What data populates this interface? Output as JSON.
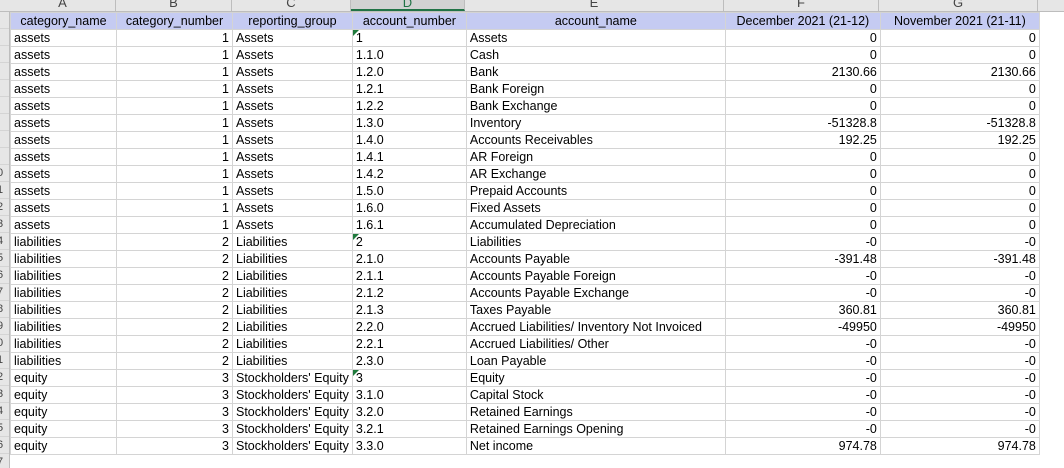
{
  "column_letters": [
    "A",
    "B",
    "C",
    "D",
    "E",
    "F",
    "G"
  ],
  "selected_column": "D",
  "row_numbers": [
    "",
    "",
    "",
    "",
    "",
    "",
    "",
    "",
    "",
    "0",
    "1",
    "2",
    "3",
    "4",
    "5",
    "6",
    "7",
    "8",
    "9",
    "0",
    "1",
    "2",
    "3",
    "4",
    "5",
    "6",
    "7"
  ],
  "headers": [
    "category_name",
    "category_number",
    "reporting_group",
    "account_number",
    "account_name",
    "December 2021 (21-12)",
    "November 2021 (21-11)"
  ],
  "rows": [
    {
      "category_name": "assets",
      "category_number": "1",
      "reporting_group": "Assets",
      "account_number": "1",
      "account_name": "Assets",
      "dec": "0",
      "nov": "0",
      "flag": true
    },
    {
      "category_name": "assets",
      "category_number": "1",
      "reporting_group": "Assets",
      "account_number": "1.1.0",
      "account_name": "Cash",
      "dec": "0",
      "nov": "0"
    },
    {
      "category_name": "assets",
      "category_number": "1",
      "reporting_group": "Assets",
      "account_number": "1.2.0",
      "account_name": "Bank",
      "dec": "2130.66",
      "nov": "2130.66"
    },
    {
      "category_name": "assets",
      "category_number": "1",
      "reporting_group": "Assets",
      "account_number": "1.2.1",
      "account_name": "Bank Foreign",
      "dec": "0",
      "nov": "0"
    },
    {
      "category_name": "assets",
      "category_number": "1",
      "reporting_group": "Assets",
      "account_number": "1.2.2",
      "account_name": "Bank Exchange",
      "dec": "0",
      "nov": "0"
    },
    {
      "category_name": "assets",
      "category_number": "1",
      "reporting_group": "Assets",
      "account_number": "1.3.0",
      "account_name": "Inventory",
      "dec": "-51328.8",
      "nov": "-51328.8"
    },
    {
      "category_name": "assets",
      "category_number": "1",
      "reporting_group": "Assets",
      "account_number": "1.4.0",
      "account_name": "Accounts Receivables",
      "dec": "192.25",
      "nov": "192.25"
    },
    {
      "category_name": "assets",
      "category_number": "1",
      "reporting_group": "Assets",
      "account_number": "1.4.1",
      "account_name": "AR Foreign",
      "dec": "0",
      "nov": "0"
    },
    {
      "category_name": "assets",
      "category_number": "1",
      "reporting_group": "Assets",
      "account_number": "1.4.2",
      "account_name": "AR Exchange",
      "dec": "0",
      "nov": "0"
    },
    {
      "category_name": "assets",
      "category_number": "1",
      "reporting_group": "Assets",
      "account_number": "1.5.0",
      "account_name": "Prepaid Accounts",
      "dec": "0",
      "nov": "0"
    },
    {
      "category_name": "assets",
      "category_number": "1",
      "reporting_group": "Assets",
      "account_number": "1.6.0",
      "account_name": "Fixed Assets",
      "dec": "0",
      "nov": "0"
    },
    {
      "category_name": "assets",
      "category_number": "1",
      "reporting_group": "Assets",
      "account_number": "1.6.1",
      "account_name": "Accumulated Depreciation",
      "dec": "0",
      "nov": "0"
    },
    {
      "category_name": "liabilities",
      "category_number": "2",
      "reporting_group": "Liabilities",
      "account_number": "2",
      "account_name": "Liabilities",
      "dec": "-0",
      "nov": "-0",
      "flag": true
    },
    {
      "category_name": "liabilities",
      "category_number": "2",
      "reporting_group": "Liabilities",
      "account_number": "2.1.0",
      "account_name": "Accounts Payable",
      "dec": "-391.48",
      "nov": "-391.48"
    },
    {
      "category_name": "liabilities",
      "category_number": "2",
      "reporting_group": "Liabilities",
      "account_number": "2.1.1",
      "account_name": "Accounts Payable Foreign",
      "dec": "-0",
      "nov": "-0"
    },
    {
      "category_name": "liabilities",
      "category_number": "2",
      "reporting_group": "Liabilities",
      "account_number": "2.1.2",
      "account_name": "Accounts Payable Exchange",
      "dec": "-0",
      "nov": "-0"
    },
    {
      "category_name": "liabilities",
      "category_number": "2",
      "reporting_group": "Liabilities",
      "account_number": "2.1.3",
      "account_name": "Taxes Payable",
      "dec": "360.81",
      "nov": "360.81"
    },
    {
      "category_name": "liabilities",
      "category_number": "2",
      "reporting_group": "Liabilities",
      "account_number": "2.2.0",
      "account_name": "Accrued Liabilities/ Inventory Not Invoiced",
      "dec": "-49950",
      "nov": "-49950"
    },
    {
      "category_name": "liabilities",
      "category_number": "2",
      "reporting_group": "Liabilities",
      "account_number": "2.2.1",
      "account_name": "Accrued Liabilities/ Other",
      "dec": "-0",
      "nov": "-0"
    },
    {
      "category_name": "liabilities",
      "category_number": "2",
      "reporting_group": "Liabilities",
      "account_number": "2.3.0",
      "account_name": "Loan Payable",
      "dec": "-0",
      "nov": "-0"
    },
    {
      "category_name": "equity",
      "category_number": "3",
      "reporting_group": "Stockholders' Equity",
      "account_number": "3",
      "account_name": "Equity",
      "dec": "-0",
      "nov": "-0",
      "flag": true
    },
    {
      "category_name": "equity",
      "category_number": "3",
      "reporting_group": "Stockholders' Equity",
      "account_number": "3.1.0",
      "account_name": "Capital Stock",
      "dec": "-0",
      "nov": "-0"
    },
    {
      "category_name": "equity",
      "category_number": "3",
      "reporting_group": "Stockholders' Equity",
      "account_number": "3.2.0",
      "account_name": "Retained Earnings",
      "dec": "-0",
      "nov": "-0"
    },
    {
      "category_name": "equity",
      "category_number": "3",
      "reporting_group": "Stockholders' Equity",
      "account_number": "3.2.1",
      "account_name": "Retained Earnings Opening",
      "dec": "-0",
      "nov": "-0"
    },
    {
      "category_name": "equity",
      "category_number": "3",
      "reporting_group": "Stockholders' Equity",
      "account_number": "3.3.0",
      "account_name": "Net income",
      "dec": "974.78",
      "nov": "974.78"
    }
  ],
  "colors": {
    "header_fill": "#c5cbf2",
    "gridline": "#d4d4d4",
    "selected_column_accent": "#217346",
    "error_flag": "#1f7a3c"
  }
}
